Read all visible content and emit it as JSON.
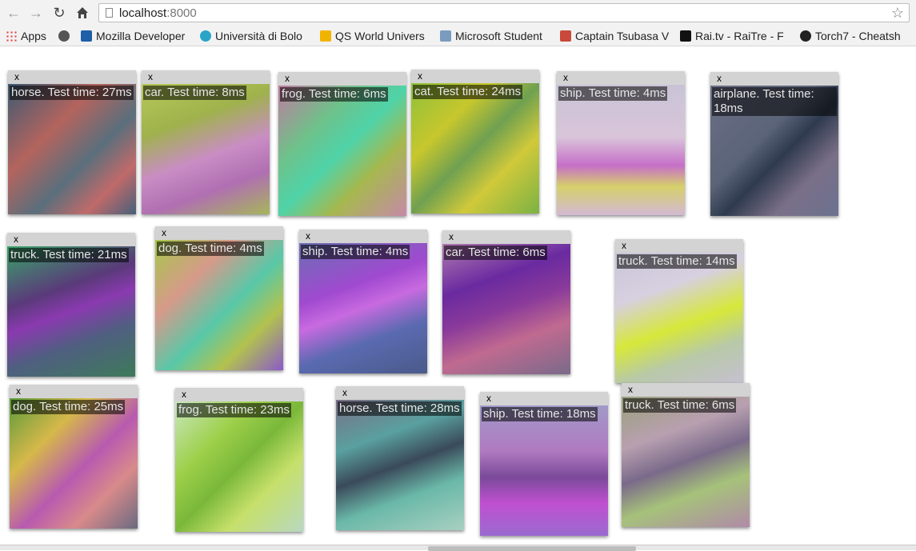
{
  "browser": {
    "url_host": "localhost",
    "url_port": ":8000",
    "bookmarks": [
      {
        "label": "Apps",
        "icon": "apps-grid-icon"
      },
      {
        "label": "",
        "icon": "history-clock-icon"
      },
      {
        "label": "Mozilla Developer",
        "icon": "mdn-icon"
      },
      {
        "label": "Università di Bolo",
        "icon": "unibo-icon"
      },
      {
        "label": "QS World Univers",
        "icon": "qs-icon"
      },
      {
        "label": "Microsoft Student",
        "icon": "microsoft-icon"
      },
      {
        "label": "Captain Tsubasa V",
        "icon": "cube-icon"
      },
      {
        "label": "Rai.tv - RaiTre - F",
        "icon": "rai-icon"
      },
      {
        "label": "Torch7 - Cheatsh",
        "icon": "github-icon"
      }
    ]
  },
  "cards": [
    {
      "close": "x",
      "label": "horse. Test time: 27ms"
    },
    {
      "close": "x",
      "label": "car. Test time: 8ms"
    },
    {
      "close": "x",
      "label": "frog. Test time: 6ms"
    },
    {
      "close": "x",
      "label": "cat. Test time: 24ms"
    },
    {
      "close": "x",
      "label": "ship. Test time: 4ms"
    },
    {
      "close": "x",
      "label": "airplane. Test time: 18ms"
    },
    {
      "close": "x",
      "label": "truck. Test time: 21ms"
    },
    {
      "close": "x",
      "label": "dog. Test time: 4ms"
    },
    {
      "close": "x",
      "label": "ship. Test time: 4ms"
    },
    {
      "close": "x",
      "label": "car. Test time: 6ms"
    },
    {
      "close": "x",
      "label": "truck. Test time: 14ms"
    },
    {
      "close": "x",
      "label": "dog. Test time: 25ms"
    },
    {
      "close": "x",
      "label": "frog. Test time: 23ms"
    },
    {
      "close": "x",
      "label": "horse. Test time: 28ms"
    },
    {
      "close": "x",
      "label": "ship. Test time: 18ms"
    },
    {
      "close": "x",
      "label": "truck. Test time: 6ms"
    }
  ]
}
